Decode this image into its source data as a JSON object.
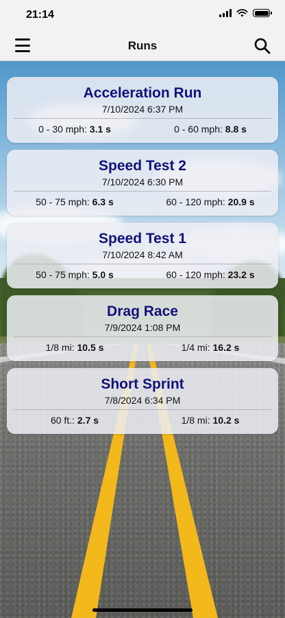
{
  "status_bar": {
    "time": "21:14"
  },
  "navbar": {
    "title": "Runs"
  },
  "runs": [
    {
      "title": "Acceleration Run",
      "date": "7/10/2024 6:37 PM",
      "metric1_label": "0 -  30 mph:",
      "metric1_value": "3.1 s",
      "metric2_label": "0 -  60 mph:",
      "metric2_value": "8.8 s"
    },
    {
      "title": "Speed Test 2",
      "date": "7/10/2024 6:30 PM",
      "metric1_label": "50 -  75 mph:",
      "metric1_value": "6.3 s",
      "metric2_label": "60 - 120 mph:",
      "metric2_value": "20.9 s"
    },
    {
      "title": "Speed Test 1",
      "date": "7/10/2024 8:42 AM",
      "metric1_label": "50 -  75 mph:",
      "metric1_value": "5.0 s",
      "metric2_label": "60 - 120 mph:",
      "metric2_value": "23.2 s"
    },
    {
      "title": "Drag Race",
      "date": "7/9/2024 1:08 PM",
      "metric1_label": "1/8 mi:",
      "metric1_value": "10.5 s",
      "metric2_label": "1/4 mi:",
      "metric2_value": "16.2 s"
    },
    {
      "title": "Short Sprint",
      "date": "7/8/2024 6:34 PM",
      "metric1_label": "60 ft.:",
      "metric1_value": "2.7 s",
      "metric2_label": "1/8 mi:",
      "metric2_value": "10.2 s"
    }
  ],
  "colors": {
    "title_text": "#12127a",
    "road_line": "#f2b81c"
  },
  "icons": {
    "menu": "hamburger-icon",
    "search": "search-icon"
  }
}
